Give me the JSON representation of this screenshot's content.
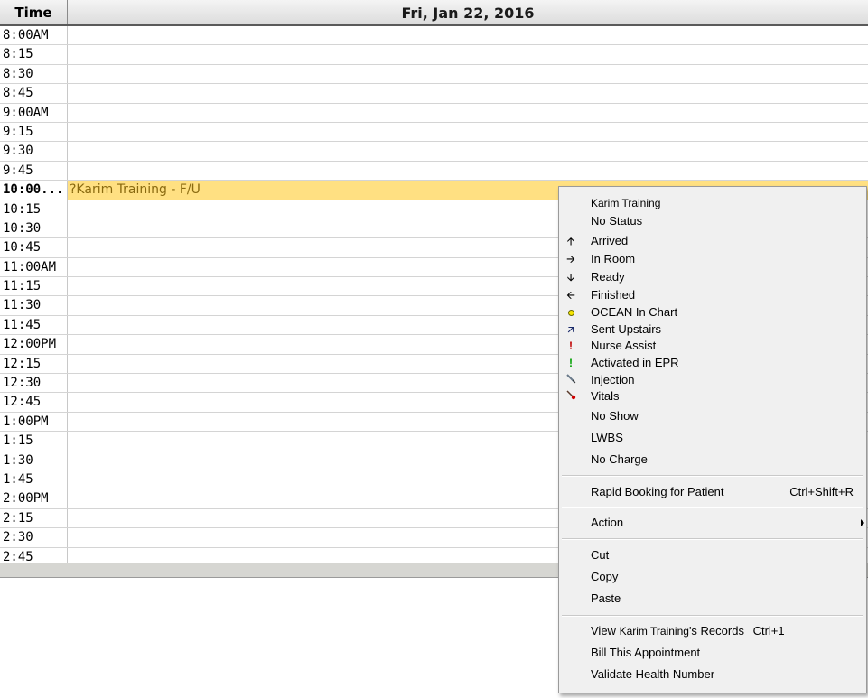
{
  "header": {
    "time_label": "Time",
    "date_label": "Fri, Jan 22, 2016"
  },
  "slots": [
    {
      "time": "8:00AM",
      "appt": ""
    },
    {
      "time": "8:15",
      "appt": ""
    },
    {
      "time": "8:30",
      "appt": ""
    },
    {
      "time": "8:45",
      "appt": ""
    },
    {
      "time": "9:00AM",
      "appt": ""
    },
    {
      "time": "9:15",
      "appt": ""
    },
    {
      "time": "9:30",
      "appt": ""
    },
    {
      "time": "9:45",
      "appt": ""
    },
    {
      "time": "10:00...",
      "appt": "?Karim Training - F/U"
    },
    {
      "time": "10:15",
      "appt": ""
    },
    {
      "time": "10:30",
      "appt": ""
    },
    {
      "time": "10:45",
      "appt": ""
    },
    {
      "time": "11:00AM",
      "appt": ""
    },
    {
      "time": "11:15",
      "appt": ""
    },
    {
      "time": "11:30",
      "appt": ""
    },
    {
      "time": "11:45",
      "appt": ""
    },
    {
      "time": "12:00PM",
      "appt": ""
    },
    {
      "time": "12:15",
      "appt": ""
    },
    {
      "time": "12:30",
      "appt": ""
    },
    {
      "time": "12:45",
      "appt": ""
    },
    {
      "time": "1:00PM",
      "appt": ""
    },
    {
      "time": "1:15",
      "appt": ""
    },
    {
      "time": "1:30",
      "appt": ""
    },
    {
      "time": "1:45",
      "appt": ""
    },
    {
      "time": "2:00PM",
      "appt": ""
    },
    {
      "time": "2:15",
      "appt": ""
    },
    {
      "time": "2:30",
      "appt": ""
    },
    {
      "time": "2:45",
      "appt": ""
    }
  ],
  "menu": {
    "patient_name": "Karim Training",
    "status_items": [
      {
        "label": "No Status",
        "icon": "none"
      },
      {
        "label": "Arrived",
        "icon": "arrow-up-icon"
      },
      {
        "label": "In Room",
        "icon": "arrow-right-icon"
      },
      {
        "label": "Ready",
        "icon": "arrow-down-icon"
      },
      {
        "label": "Finished",
        "icon": "arrow-left-icon"
      },
      {
        "label": "OCEAN In Chart",
        "icon": "yellow-dot-icon"
      },
      {
        "label": "Sent Upstairs",
        "icon": "diagonal-arrow-icon"
      },
      {
        "label": "Nurse Assist",
        "icon": "red-exclamation-icon"
      },
      {
        "label": "Activated in EPR",
        "icon": "green-exclamation-icon"
      },
      {
        "label": "Injection",
        "icon": "syringe-icon"
      },
      {
        "label": "Vitals",
        "icon": "thermometer-icon"
      },
      {
        "label": "No Show",
        "icon": "none"
      },
      {
        "label": "LWBS",
        "icon": "none"
      },
      {
        "label": "No Charge",
        "icon": "none"
      }
    ],
    "rapid_booking": {
      "label": "Rapid Booking for Patient",
      "shortcut": "Ctrl+Shift+R"
    },
    "action": {
      "label": "Action"
    },
    "cut": "Cut",
    "copy": "Copy",
    "paste": "Paste",
    "view_records": {
      "prefix": "View",
      "name": "Karim Training",
      "suffix": "'s Records",
      "shortcut": "Ctrl+1"
    },
    "bill": "Bill This Appointment",
    "validate": "Validate Health Number"
  },
  "colors": {
    "booked_slot": "#ffe082",
    "booked_text": "#8a6a10"
  }
}
